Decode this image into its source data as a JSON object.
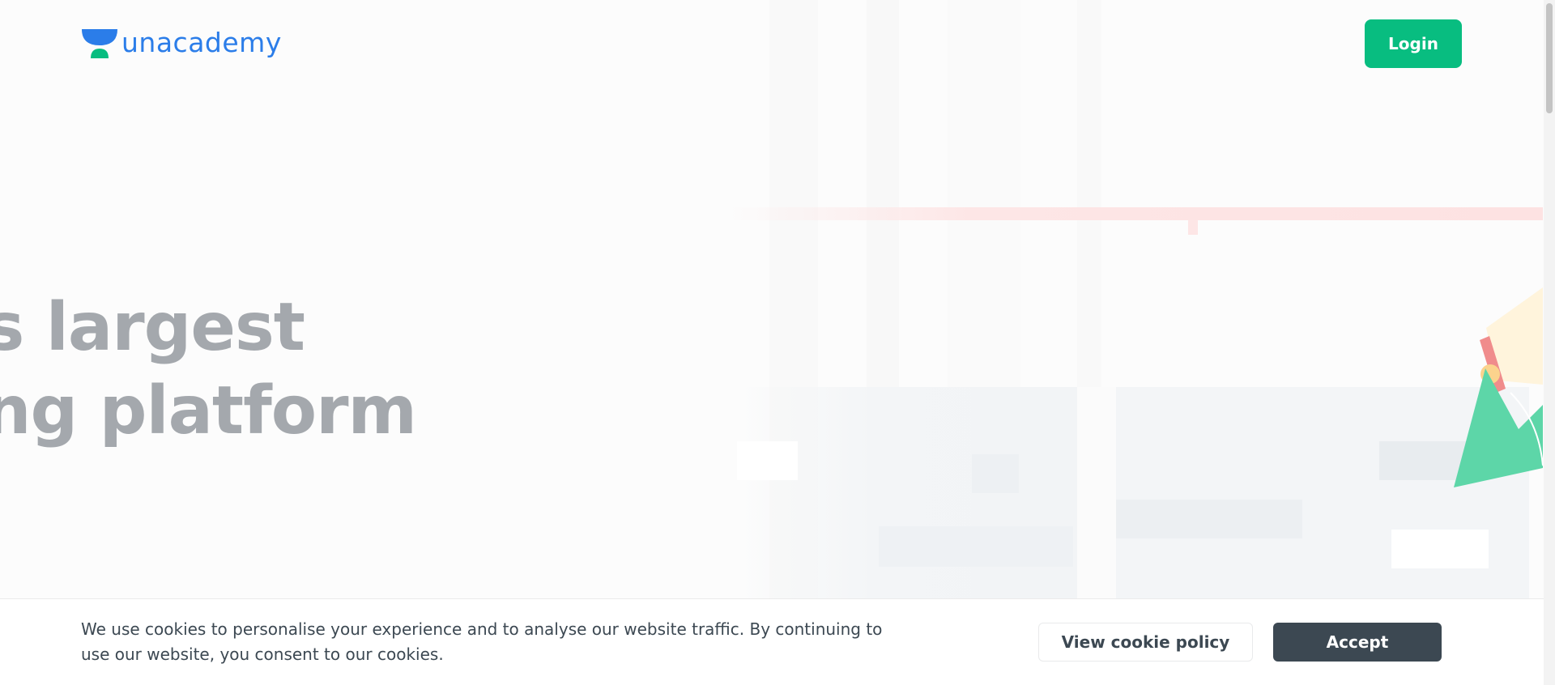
{
  "header": {
    "logo_text": "unacademy",
    "login_label": "Login"
  },
  "hero": {
    "line1": "a’s largest",
    "line2": "ning platform"
  },
  "cookie_banner": {
    "message": "We use cookies to personalise your experience and to analyse our website traffic. By continuing to use our website, you consent to our cookies.",
    "view_policy_label": "View cookie policy",
    "accept_label": "Accept"
  },
  "colors": {
    "brand_blue": "#2b7de9",
    "brand_green": "#08bd80",
    "headline_gray": "#a4a8ad",
    "banner_text": "#3c4852",
    "accept_bg": "#3c4852"
  },
  "icons": {
    "logo": "unacademy-logo-icon"
  }
}
